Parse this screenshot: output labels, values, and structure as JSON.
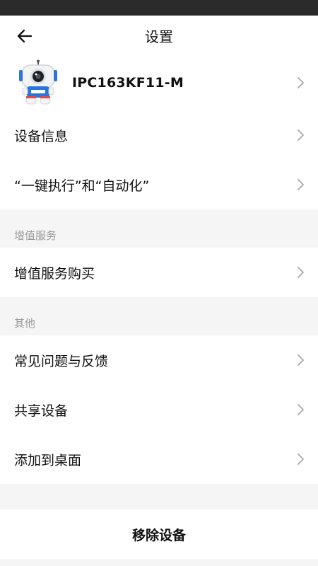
{
  "header": {
    "title": "设置"
  },
  "device": {
    "name": "IPC163KF11-M"
  },
  "group1": [
    {
      "label": "设备信息"
    },
    {
      "label": "“一键执行”和“自动化”"
    }
  ],
  "section_value_added": {
    "title": "增值服务",
    "items": [
      {
        "label": "增值服务购买"
      }
    ]
  },
  "section_other": {
    "title": "其他",
    "items": [
      {
        "label": "常见问题与反馈"
      },
      {
        "label": "共享设备"
      },
      {
        "label": "添加到桌面"
      }
    ]
  },
  "actions": {
    "remove_label": "移除设备"
  },
  "icons": {
    "back": "back-arrow-icon",
    "chevron": "chevron-right-icon",
    "device": "camera-device-icon"
  },
  "colors": {
    "statusbar": "#2b2b2b",
    "section_label": "#9a9a9a",
    "background": "#f5f5f5"
  }
}
